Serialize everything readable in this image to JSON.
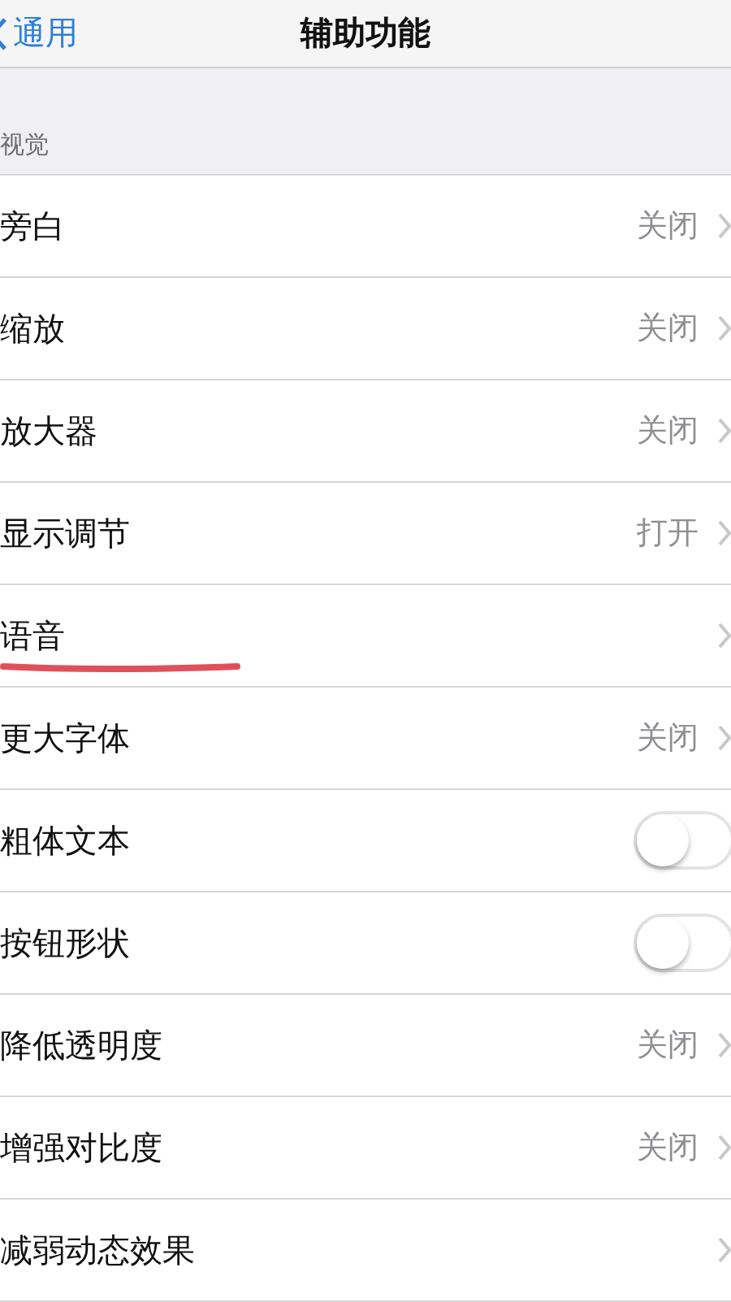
{
  "nav": {
    "back": "通用",
    "title": "辅助功能"
  },
  "section": "视觉",
  "rows": [
    {
      "kind": "link",
      "label": "旁白",
      "value": "关闭",
      "marked": false
    },
    {
      "kind": "link",
      "label": "缩放",
      "value": "关闭",
      "marked": false
    },
    {
      "kind": "link",
      "label": "放大器",
      "value": "关闭",
      "marked": false
    },
    {
      "kind": "link",
      "label": "显示调节",
      "value": "打开",
      "marked": false
    },
    {
      "kind": "link",
      "label": "语音",
      "marked": true
    },
    {
      "kind": "link",
      "label": "更大字体",
      "value": "关闭",
      "marked": false
    },
    {
      "kind": "toggle",
      "label": "粗体文本",
      "on": false,
      "marked": false
    },
    {
      "kind": "toggle",
      "label": "按钮形状",
      "on": false,
      "marked": false
    },
    {
      "kind": "link",
      "label": "降低透明度",
      "value": "关闭",
      "marked": false
    },
    {
      "kind": "link",
      "label": "增强对比度",
      "value": "关闭",
      "marked": false
    },
    {
      "kind": "link",
      "label": "减弱动态效果",
      "marked": false
    }
  ]
}
